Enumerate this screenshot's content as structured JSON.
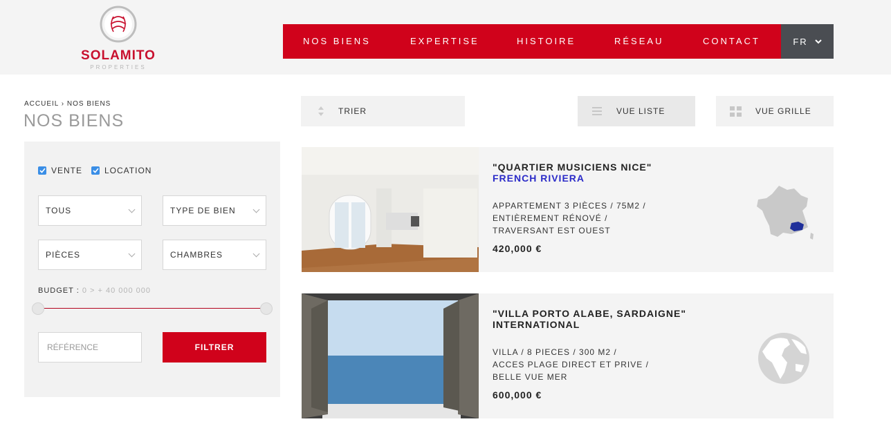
{
  "header": {
    "brand_name": "SOLAMITO",
    "brand_sub": "PROPERTIES",
    "nav": [
      "NOS BIENS",
      "EXPERTISE",
      "HISTOIRE",
      "RÉSEAU",
      "CONTACT"
    ],
    "lang": "FR"
  },
  "breadcrumb": {
    "home": "ACCUEIL",
    "sep": "›",
    "current": "NOS BIENS"
  },
  "page_title": "NOS BIENS",
  "filters": {
    "checkbox_sale": "VENTE",
    "checkbox_rent": "LOCATION",
    "select_all": "TOUS",
    "select_type": "TYPE DE BIEN",
    "select_rooms": "PIÈCES",
    "select_bedrooms": "CHAMBRES",
    "budget_label": "BUDGET :",
    "budget_range": "0 > + 40 000 000",
    "reference_placeholder": "RÉFÉRENCE",
    "filter_button": "FILTRER"
  },
  "toolbar": {
    "sort": "TRIER",
    "list_view": "VUE LISTE",
    "grid_view": "VUE GRILLE"
  },
  "listings": [
    {
      "title": "\"QUARTIER MUSICIENS NICE\"",
      "region": "FRENCH RIVIERA",
      "region_color": "#2b2bc8",
      "desc": [
        "APPARTEMENT 3 PIÈCES / 75M2 /",
        "ENTIÈREMENT RÉNOVÉ /",
        "TRAVERSANT EST OUEST"
      ],
      "price": "420,000 €",
      "map_icon": "france-map-icon"
    },
    {
      "title": "\"VILLA PORTO ALABE, SARDAIGNE\"",
      "region": "INTERNATIONAL",
      "region_color": "#222222",
      "desc": [
        "VILLA / 8 PIECES / 300 M2 /",
        "ACCES PLAGE DIRECT ET PRIVE /",
        "BELLE VUE MER"
      ],
      "price": "600,000 €",
      "map_icon": "globe-icon"
    }
  ],
  "colors": {
    "brand_red": "#d0021b",
    "lang_bg": "#4a4d52",
    "checkbox_blue": "#3a8ee6"
  }
}
